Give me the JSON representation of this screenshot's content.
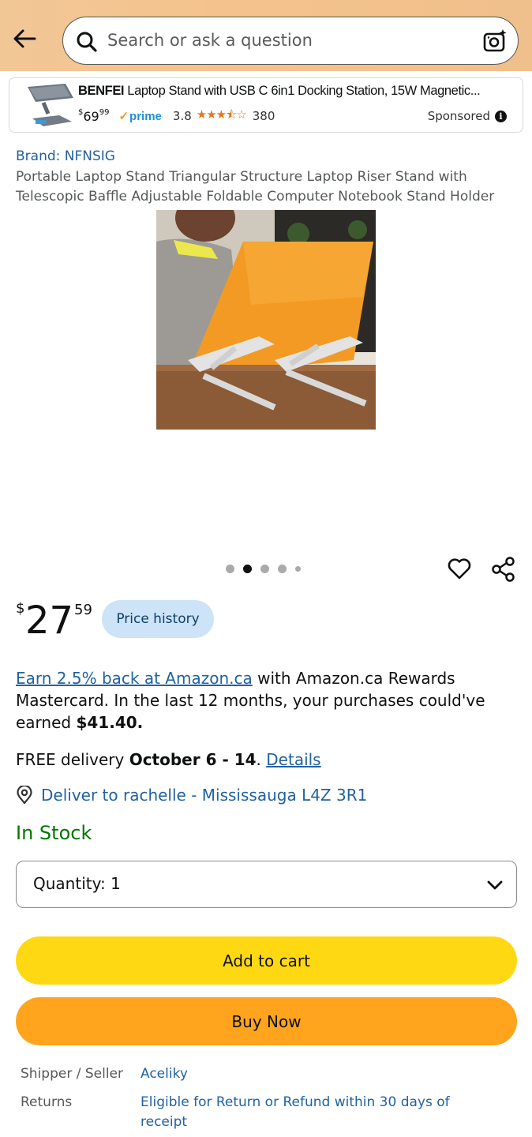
{
  "header": {
    "search_placeholder": "Search or ask a question"
  },
  "sponsored_ad": {
    "brand": "BENFEI",
    "title_rest": " Laptop Stand with USB C 6in1 Docking Station, 15W Magnetic...",
    "price_symbol": "$",
    "price_whole": "69",
    "price_fraction": "99",
    "prime_label": "prime",
    "rating": "3.8",
    "stars": "★★★⯪☆",
    "rating_value": 3.8,
    "review_count": "380",
    "sponsored_label": "Sponsored"
  },
  "product": {
    "brand_line": "Brand: NFNSIG",
    "title": "Portable Laptop Stand Triangular Structure Laptop Riser Stand with Telescopic Baffle Adjustable Foldable Computer Notebook Stand Holder",
    "image_count": 5,
    "active_image_index": 1
  },
  "price": {
    "symbol": "$",
    "whole": "27",
    "fraction": "59",
    "history_button": "Price history"
  },
  "rewards": {
    "link_text": "Earn 2.5% back at Amazon.ca",
    "text_1": " with Amazon.ca Rewards Mastercard. In the last 12 months, your purchases could've earned ",
    "amount": "$41.40."
  },
  "delivery": {
    "prefix": "FREE delivery ",
    "dates": "October 6 - 14",
    "suffix": ". ",
    "details_link": "Details",
    "deliver_to": "Deliver to rachelle - Mississauga L4Z 3R1"
  },
  "stock_status": "In Stock",
  "quantity": {
    "label": "Quantity:",
    "value": "1"
  },
  "buttons": {
    "add_to_cart": "Add to cart",
    "buy_now": "Buy Now"
  },
  "info": {
    "seller_label": "Shipper / Seller",
    "seller_value": "Aceliky",
    "returns_label": "Returns",
    "returns_value": "Eligible for Return or Refund within 30 days of receipt"
  },
  "colors": {
    "header_bg": "#f2c796",
    "link": "#2162a1",
    "add_to_cart": "#ffd814",
    "buy_now": "#ffa41c",
    "in_stock": "#007600",
    "price_history_bg": "#cde3f8"
  }
}
